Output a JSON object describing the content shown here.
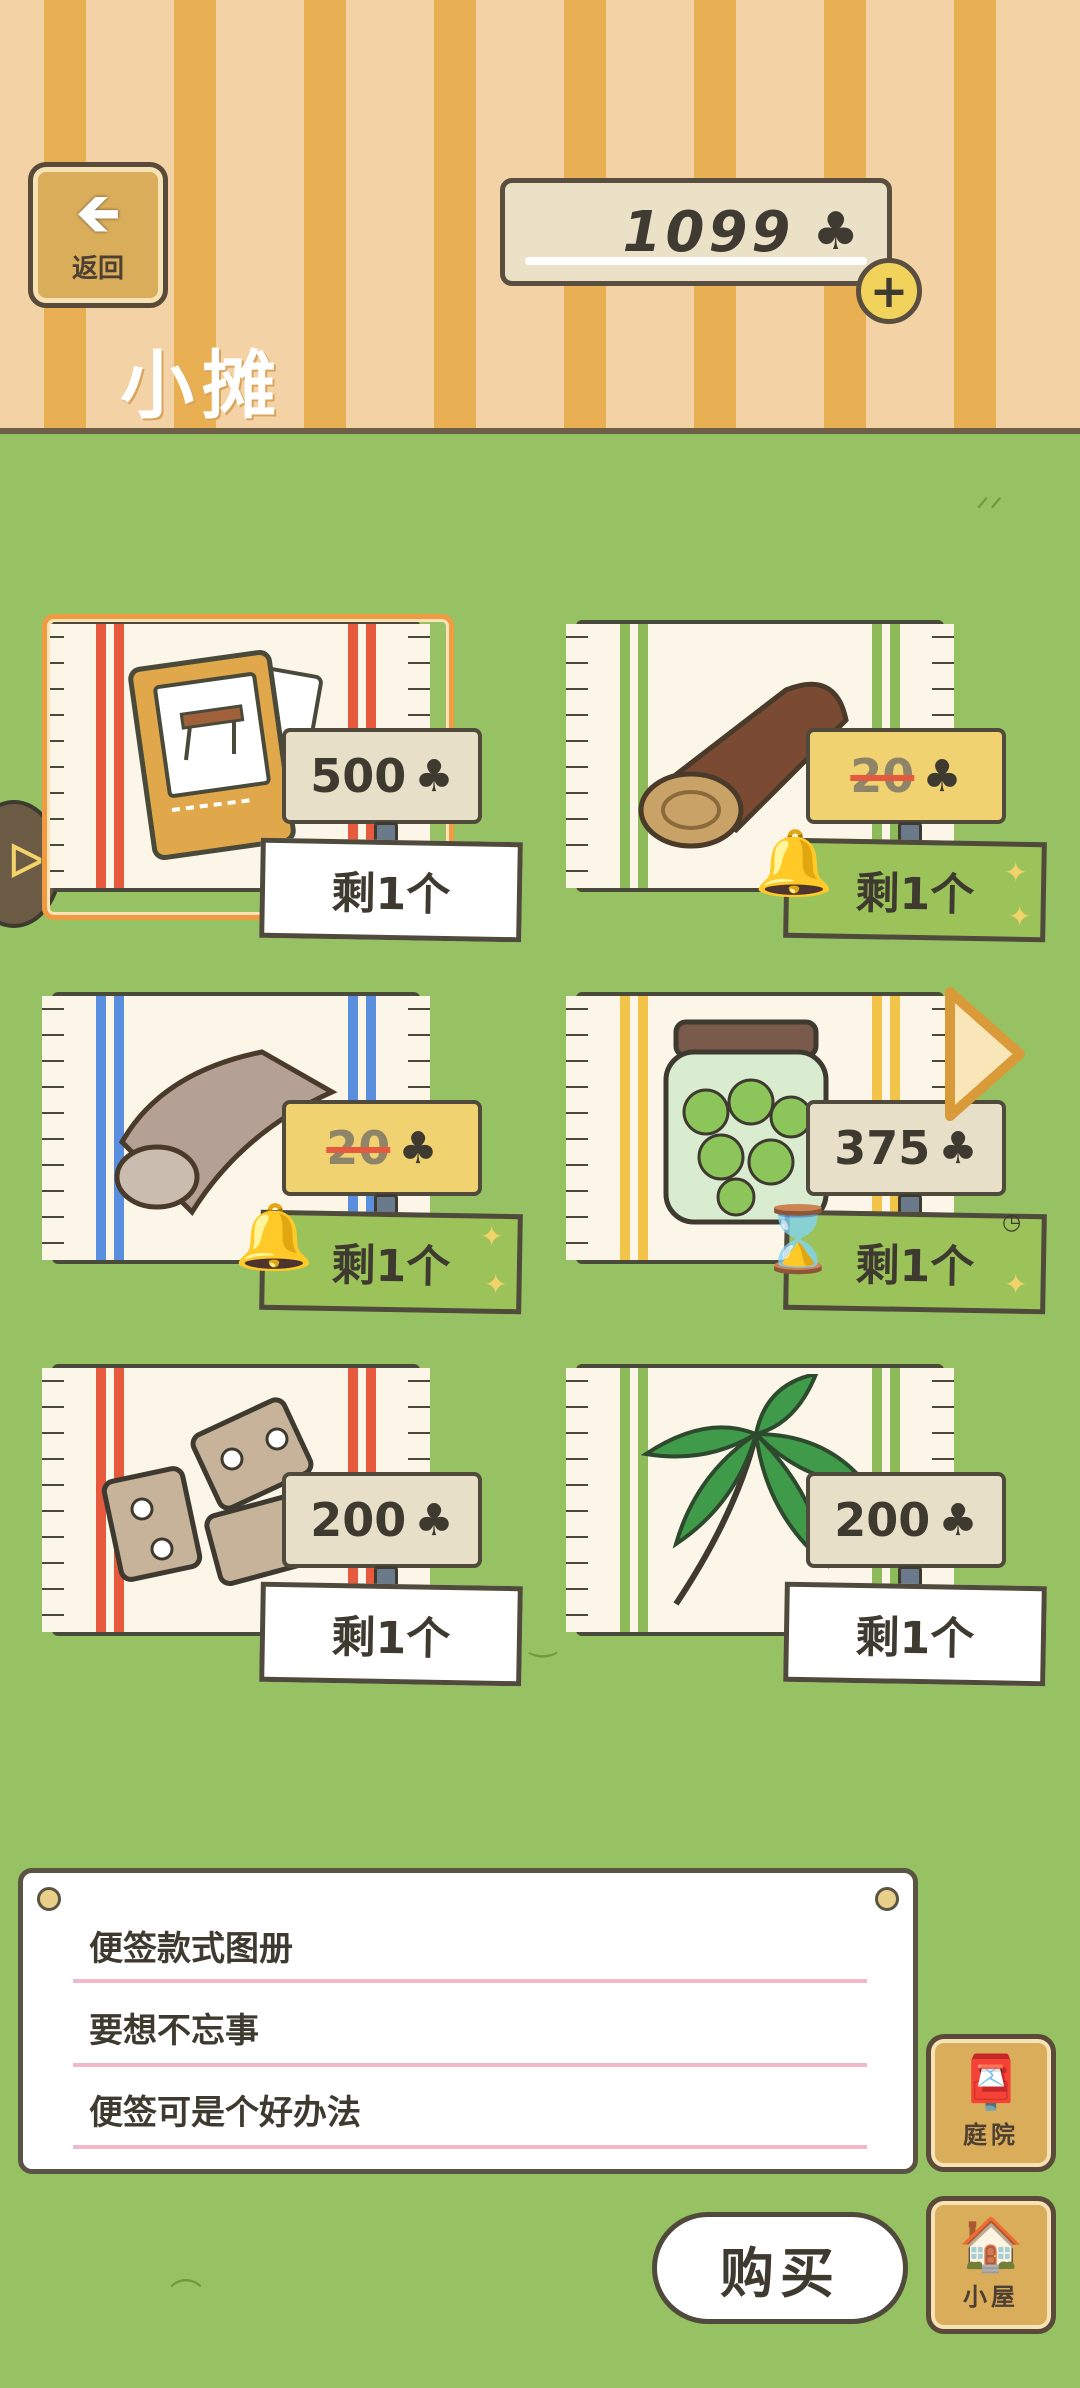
{
  "header": {
    "back_icon": "arrow-left-icon",
    "back_label": "返回",
    "title": "小摊",
    "currency_amount": "1099",
    "currency_symbol": "♣",
    "add_symbol": "+"
  },
  "items": [
    {
      "name": "便签款式图册",
      "price": "500",
      "on_sale": false,
      "stock": "剩1个",
      "selected": true,
      "icon": "book-icon"
    },
    {
      "name": "木头",
      "price": "20",
      "on_sale": true,
      "stock": "剩1个",
      "selected": false,
      "icon": "log-icon"
    },
    {
      "name": "布",
      "price": "20",
      "on_sale": true,
      "stock": "剩1个",
      "selected": false,
      "icon": "cloth-roll-icon"
    },
    {
      "name": "罐子",
      "price": "375",
      "on_sale": false,
      "stock": "剩1个",
      "selected": false,
      "icon": "jar-icon"
    },
    {
      "name": "合页",
      "price": "200",
      "on_sale": false,
      "stock": "剩1个",
      "selected": false,
      "icon": "hinges-icon"
    },
    {
      "name": "叶子",
      "price": "200",
      "on_sale": false,
      "stock": "剩1个",
      "selected": false,
      "icon": "leaf-icon"
    }
  ],
  "clover": "♣",
  "note": {
    "line1": "便签款式图册",
    "line2": "要想不忘事",
    "line3": "便签可是个好办法"
  },
  "buttons": {
    "buy": "购买",
    "yard": "庭院",
    "house": "小屋"
  },
  "colors": {
    "grass": "#97c263",
    "header_stripe_light": "#f3d3a6",
    "header_stripe_dark": "#e8b052",
    "selected_frame": "#f09b42",
    "sale_tag": "#f1d270"
  }
}
